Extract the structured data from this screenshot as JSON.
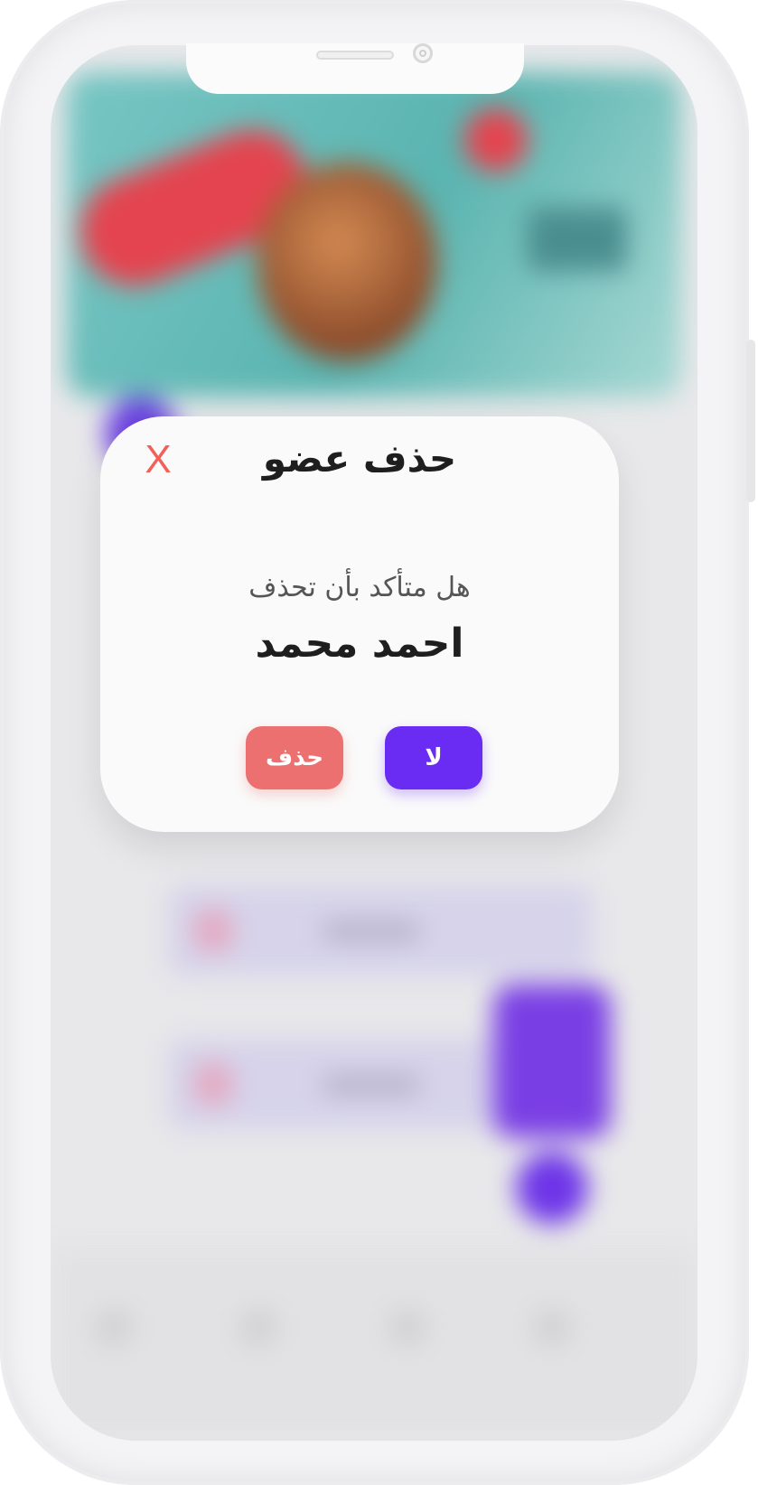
{
  "dialog": {
    "title": "حذف عضو",
    "close_label": "X",
    "question": "هل متأكد بأن  تحذف",
    "member_name": "احمد محمد",
    "delete_label": "حذف",
    "no_label": "لا"
  },
  "colors": {
    "close": "#f2605a",
    "delete_button": "#ec7070",
    "no_button": "#6a2cf2"
  },
  "icons": {
    "close": "close-icon"
  }
}
